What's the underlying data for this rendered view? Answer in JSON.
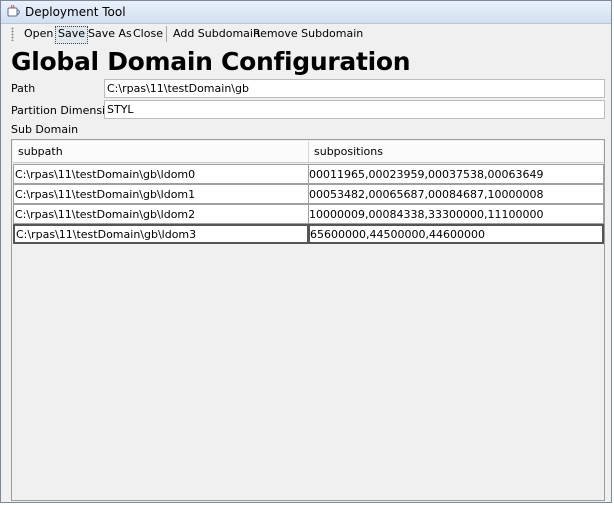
{
  "window": {
    "title": "Deployment Tool"
  },
  "toolbar": {
    "open": "Open",
    "save": "Save",
    "save_as": "Save As",
    "close": "Close",
    "add_subdomain": "Add Subdomain",
    "remove_subdomain": "Remove Subdomain"
  },
  "page": {
    "heading": "Global Domain Configuration"
  },
  "form": {
    "path_label": "Path",
    "path_value": "C:\\rpas\\11\\testDomain\\gb",
    "partition_label": "Partition Dimension",
    "partition_value": "STYL",
    "subdomain_label": "Sub Domain"
  },
  "table": {
    "columns": [
      "subpath",
      "subpositions"
    ],
    "rows": [
      {
        "subpath": "C:\\rpas\\11\\testDomain\\gb\\ldom0",
        "subpositions": "00011965,00023959,00037538,00063649"
      },
      {
        "subpath": "C:\\rpas\\11\\testDomain\\gb\\ldom1",
        "subpositions": "00053482,00065687,00084687,10000008"
      },
      {
        "subpath": "C:\\rpas\\11\\testDomain\\gb\\ldom2",
        "subpositions": "10000009,00084338,33300000,11100000"
      },
      {
        "subpath": "C:\\rpas\\11\\testDomain\\gb\\ldom3",
        "subpositions": "65600000,44500000,44600000"
      }
    ]
  }
}
